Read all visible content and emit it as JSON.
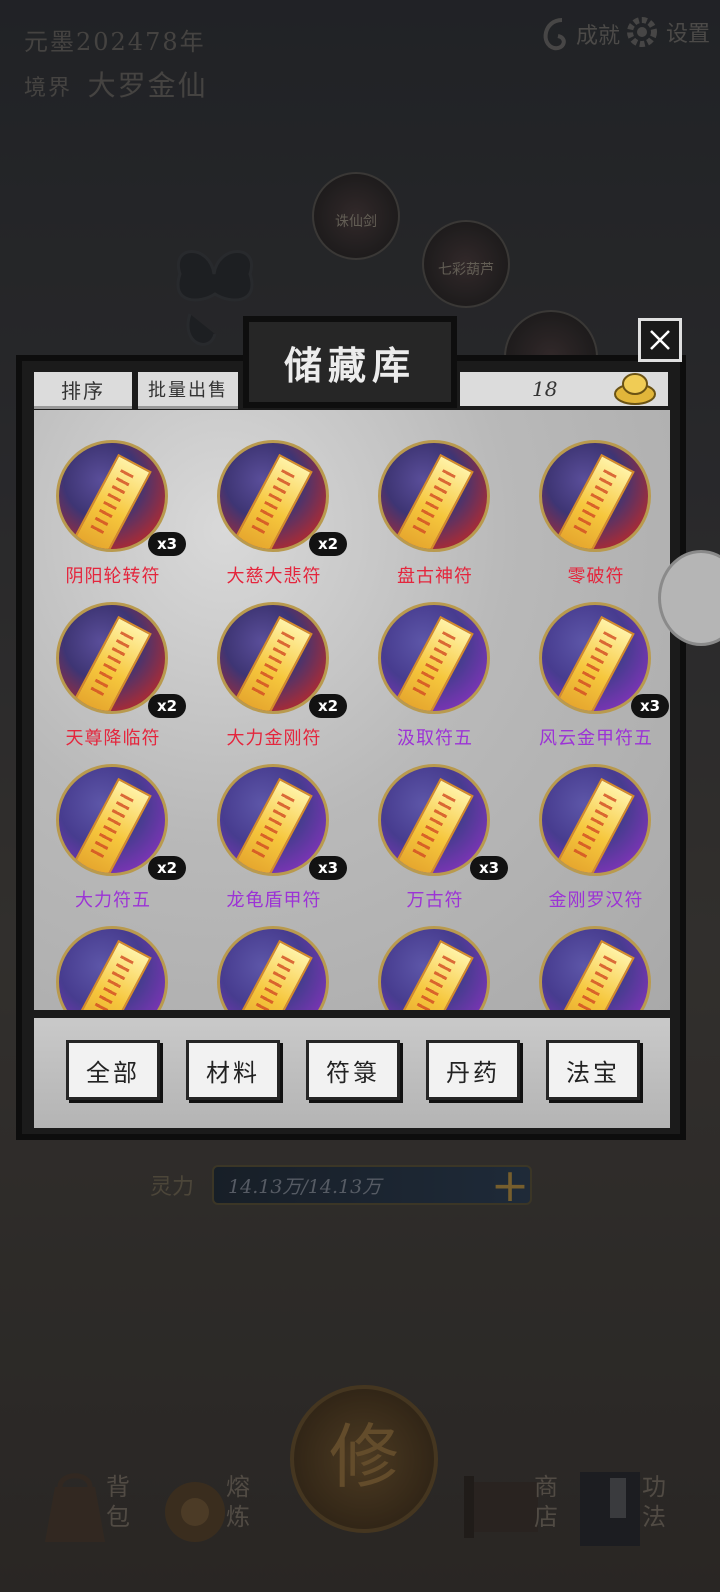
{
  "hud": {
    "era": "元墨202478年",
    "realm_label": "境界",
    "realm_value": "大罗金仙",
    "achievements_label": "成就",
    "settings_label": "设置"
  },
  "background": {
    "orbs": [
      "诛仙剑",
      "七彩葫芦"
    ],
    "mana_label": "灵力",
    "mana_value": "14.13万/14.13万",
    "cultivate_glyph": "修",
    "nav": [
      {
        "label": "背包",
        "icon": "bag-icon"
      },
      {
        "label": "熔炼",
        "icon": "smelt-icon"
      },
      {
        "label": "商店",
        "icon": "shop-scroll-icon"
      },
      {
        "label": "功法",
        "icon": "book-icon"
      }
    ]
  },
  "modal": {
    "title": "储藏库",
    "sort_label": "排序",
    "bulk_sell_label": "批量出售",
    "currency_amount": "18",
    "items": [
      {
        "name": "阴阳轮转符",
        "qty": "x3",
        "tone": "red"
      },
      {
        "name": "大慈大悲符",
        "qty": "x2",
        "tone": "red"
      },
      {
        "name": "盘古神符",
        "qty": "",
        "tone": "red"
      },
      {
        "name": "零破符",
        "qty": "",
        "tone": "red"
      },
      {
        "name": "天尊降临符",
        "qty": "x2",
        "tone": "red"
      },
      {
        "name": "大力金刚符",
        "qty": "x2",
        "tone": "red"
      },
      {
        "name": "汲取符五",
        "qty": "",
        "tone": "purple"
      },
      {
        "name": "风云金甲符五",
        "qty": "x3",
        "tone": "purple"
      },
      {
        "name": "大力符五",
        "qty": "x2",
        "tone": "purple"
      },
      {
        "name": "龙龟盾甲符",
        "qty": "x3",
        "tone": "purple"
      },
      {
        "name": "万古符",
        "qty": "x3",
        "tone": "purple"
      },
      {
        "name": "金刚罗汉符",
        "qty": "",
        "tone": "purple"
      },
      {
        "name": "",
        "qty": "",
        "tone": "purple"
      },
      {
        "name": "",
        "qty": "",
        "tone": "purple"
      },
      {
        "name": "",
        "qty": "",
        "tone": "purple"
      },
      {
        "name": "",
        "qty": "",
        "tone": "purple"
      }
    ],
    "tabs": [
      "全部",
      "材料",
      "符箓",
      "丹药",
      "法宝"
    ]
  },
  "colors": {
    "rare_red": "#e4263d",
    "epic_purple": "#9c33d6",
    "gold_border": "#b99a4e"
  }
}
